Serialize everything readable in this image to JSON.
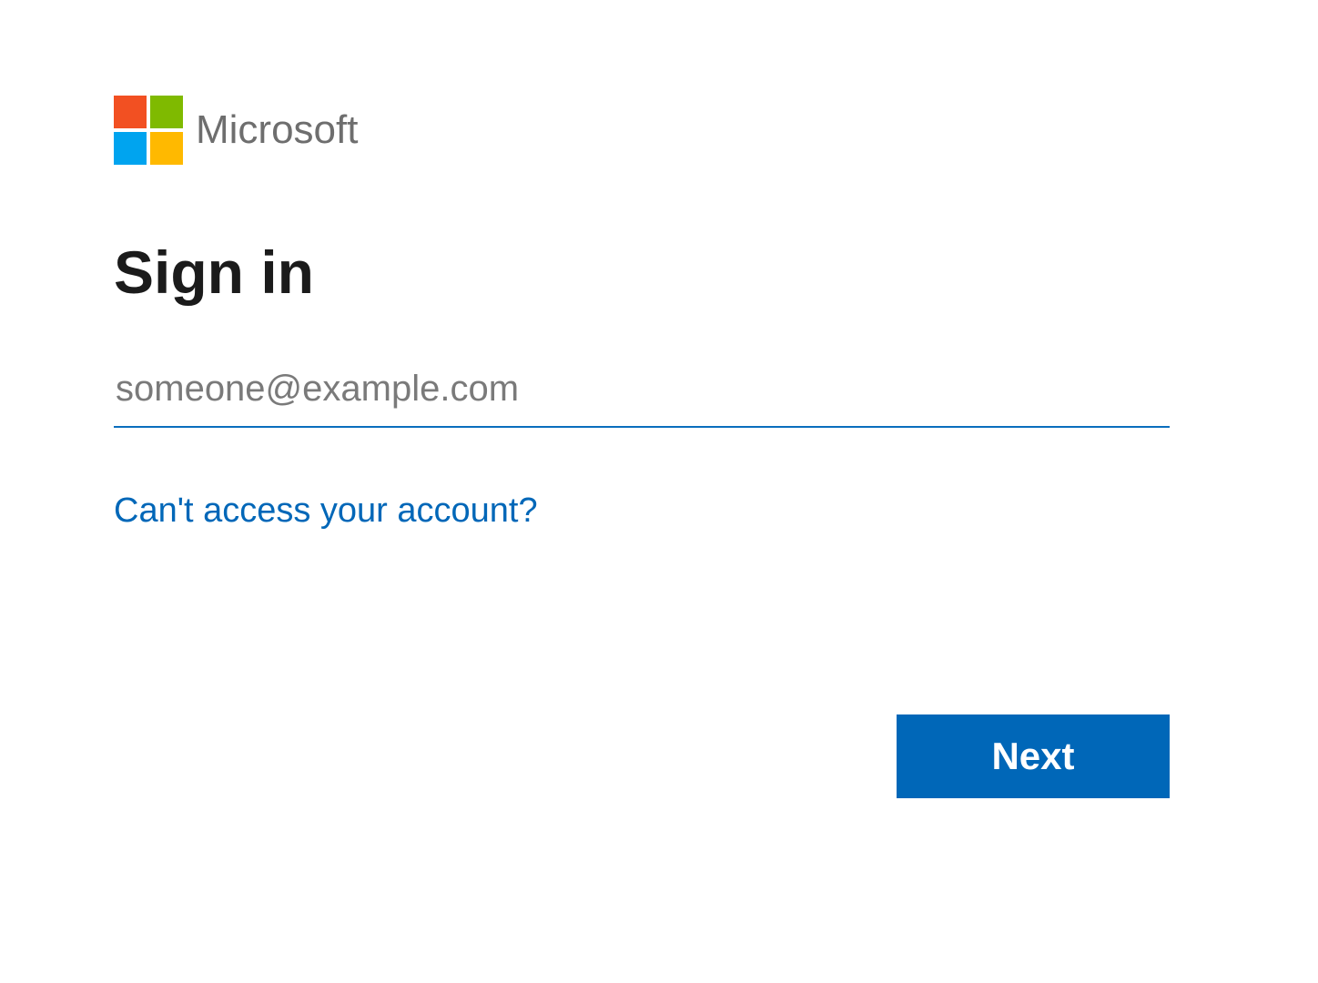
{
  "brand": {
    "name": "Microsoft",
    "logo_colors": {
      "top_left": "#f25022",
      "top_right": "#7fba00",
      "bottom_left": "#00a4ef",
      "bottom_right": "#ffb900"
    }
  },
  "signin": {
    "heading": "Sign in",
    "email_value": "",
    "email_placeholder": "someone@example.com",
    "access_link_label": "Can't access your account?",
    "next_button_label": "Next"
  },
  "colors": {
    "primary": "#0067b8",
    "text_muted": "#6e6e6e",
    "input_underline": "#0a6ebd"
  }
}
